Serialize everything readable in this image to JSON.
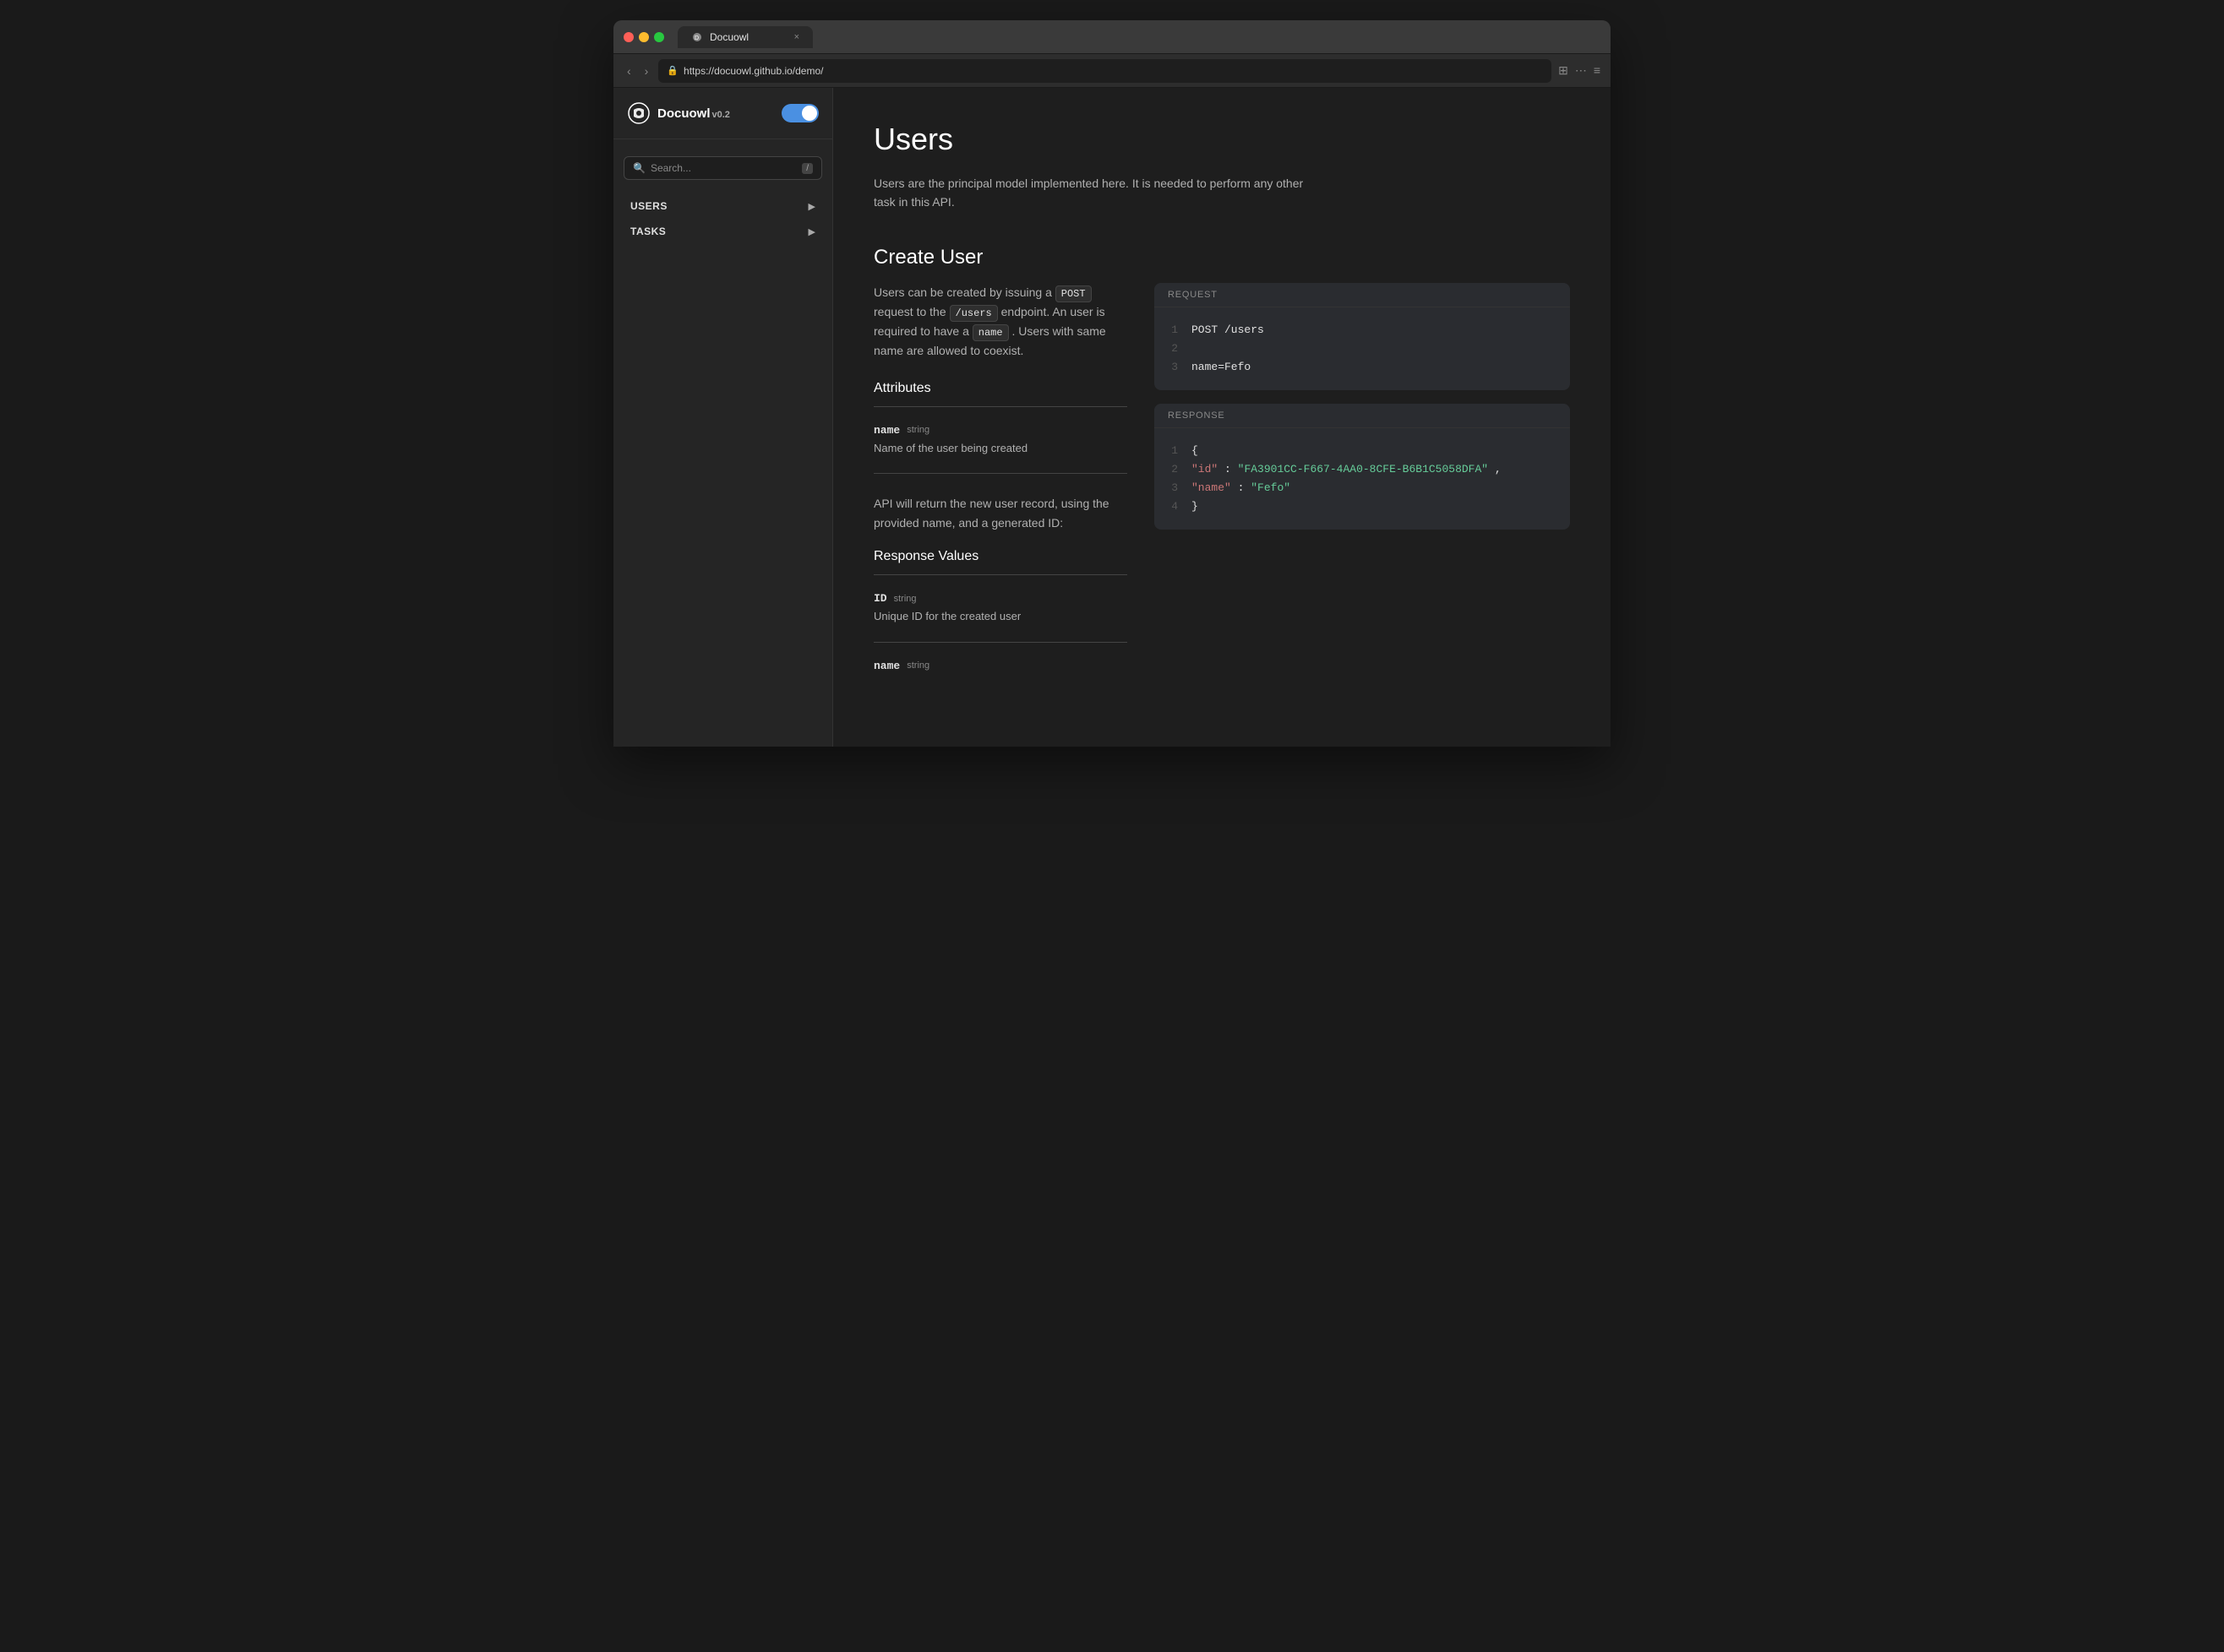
{
  "browser": {
    "tab_label": "Docuowl",
    "url": "https://docuowl.github.io/demo/",
    "close_symbol": "×",
    "nav_back": "‹",
    "nav_forward": "›"
  },
  "sidebar": {
    "brand": "Docuowl",
    "version": "v0.2",
    "search_placeholder": "Search...",
    "search_slash": "/",
    "toggle_on": true,
    "nav_items": [
      {
        "id": "users",
        "label": "USERS"
      },
      {
        "id": "tasks",
        "label": "TASKS"
      }
    ]
  },
  "main": {
    "page_title": "Users",
    "page_description": "Users are the principal model implemented here. It is needed to perform any other task in this API.",
    "section_title": "Create User",
    "section_description_1": "Users can be created by issuing a",
    "section_description_code1": "POST",
    "section_description_2": "request to the",
    "section_description_code2": "/users",
    "section_description_3": "endpoint. An user is required to have a",
    "section_description_code3": "name",
    "section_description_4": ". Users with same name are allowed to coexist.",
    "attributes_title": "Attributes",
    "attr_name_label": "name",
    "attr_name_type": "string",
    "attr_name_desc": "Name of the user being created",
    "extended_desc": "API will return the new user record, using the provided name, and a generated ID:",
    "response_values_title": "Response Values",
    "attr_id_label": "ID",
    "attr_id_type": "string",
    "attr_id_desc": "Unique ID for the created user",
    "attr_name2_label": "name",
    "attr_name2_type": "string",
    "request_block": {
      "header": "REQUEST",
      "lines": [
        {
          "num": "1",
          "text": "POST /users",
          "type": "default"
        },
        {
          "num": "2",
          "text": "",
          "type": "default"
        },
        {
          "num": "3",
          "text": "name=Fefo",
          "type": "default"
        }
      ]
    },
    "response_block": {
      "header": "RESPONSE",
      "lines": [
        {
          "num": "1",
          "text": "{",
          "type": "default"
        },
        {
          "num": "2",
          "key": "\"id\"",
          "colon": ": ",
          "value": "\"FA3901CC-F667-4AA0-8CFE-B6B1C5058DFA\"",
          "comma": ",",
          "type": "keyval"
        },
        {
          "num": "3",
          "key": "\"name\"",
          "colon": ": ",
          "value": "\"Fefo\"",
          "type": "keyval"
        },
        {
          "num": "4",
          "text": "}",
          "type": "default"
        }
      ]
    }
  }
}
